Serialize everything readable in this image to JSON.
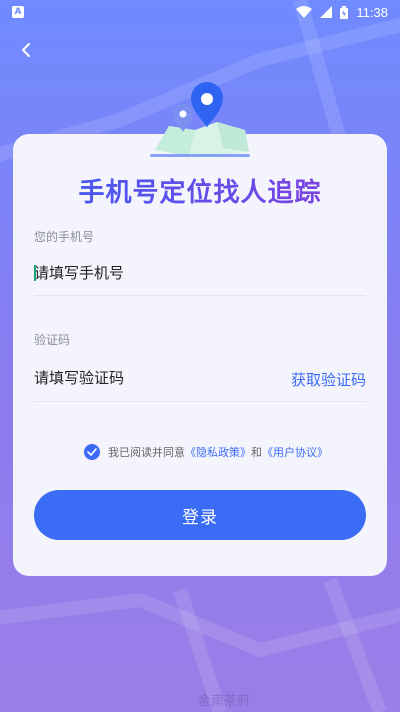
{
  "status_bar": {
    "notification_badge": "A",
    "time": "11:38"
  },
  "card": {
    "title": "手机号定位找人追踪",
    "phone": {
      "label": "您的手机号",
      "placeholder": "请填写手机号"
    },
    "code": {
      "label": "验证码",
      "placeholder": "请填写验证码",
      "get_code_label": "获取验证码"
    },
    "agreement": {
      "prefix": "我已阅读并同意",
      "privacy_link": "《隐私政策》",
      "and": "和",
      "user_link": "《用户协议》",
      "checked": true
    },
    "login_label": "登录"
  },
  "map_labels": {
    "street_1": "金南茶府"
  },
  "colors": {
    "accent": "#3b6cf6",
    "caret": "#1aa37a"
  },
  "icons": {
    "back": "back-arrow-icon",
    "map_pin": "map-pin-icon",
    "check": "check-icon",
    "wifi": "wifi-icon",
    "signal": "signal-icon",
    "battery": "battery-icon"
  }
}
